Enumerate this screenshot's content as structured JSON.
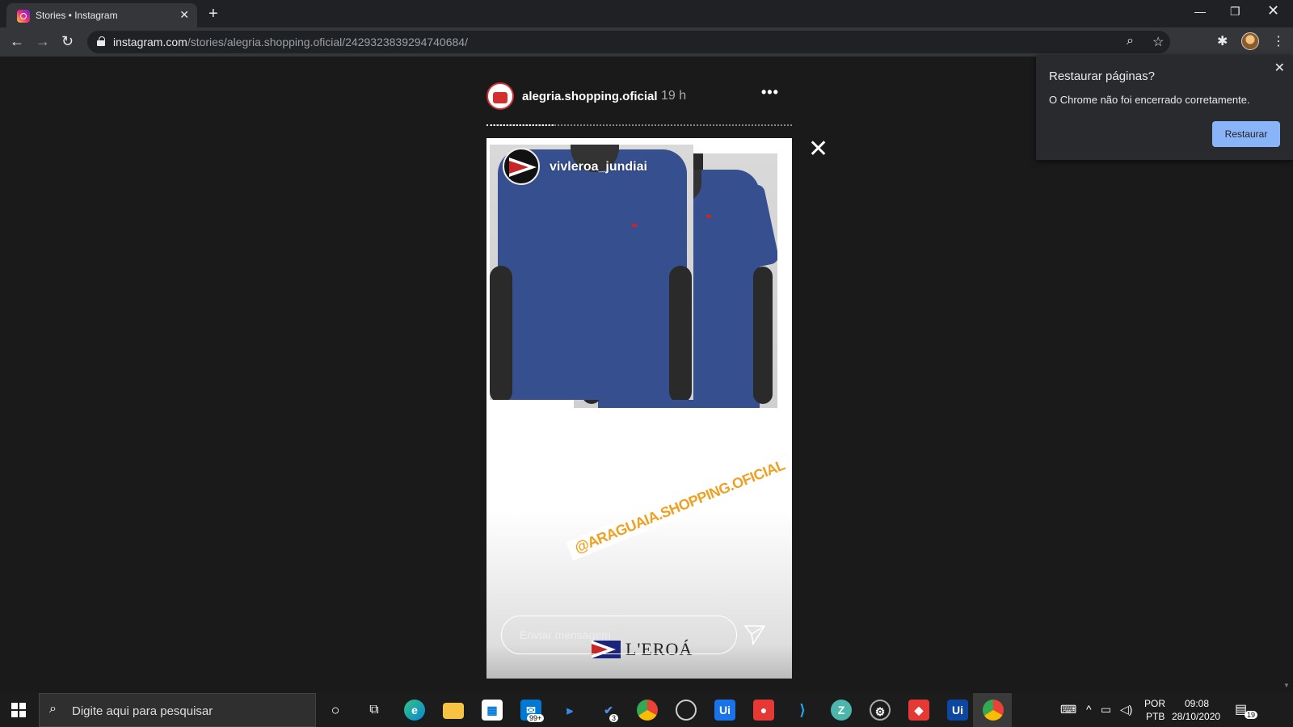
{
  "browser": {
    "tab_title": "Stories • Instagram",
    "url_host": "instagram.com",
    "url_path": "/stories/alegria.shopping.oficial/2429323839294740684/"
  },
  "story": {
    "username": "alegria.shopping.oficial",
    "time": "19 h",
    "more_label": "•••",
    "progress": 0.22,
    "content_username": "vivleroa_jundiai",
    "sticker_text": "@ARAGUAIA.SHOPPING.OFICIAL",
    "brand_text": "L'EROÁ",
    "reply_placeholder": "Enviar mensagem"
  },
  "restore_popup": {
    "title": "Restaurar páginas?",
    "message": "O Chrome não foi encerrado corretamente.",
    "button": "Restaurar"
  },
  "taskbar": {
    "search_placeholder": "Digite aqui para pesquisar",
    "mail_badge": "99+",
    "todo_badge": "3",
    "lang_top": "POR",
    "lang_bottom": "PTB",
    "time": "09:08",
    "date": "28/10/2020",
    "notif_count": "19"
  },
  "colors": {
    "accent": "#8ab4f8",
    "shirt": "#36508f",
    "sticker": "#f0a020"
  }
}
